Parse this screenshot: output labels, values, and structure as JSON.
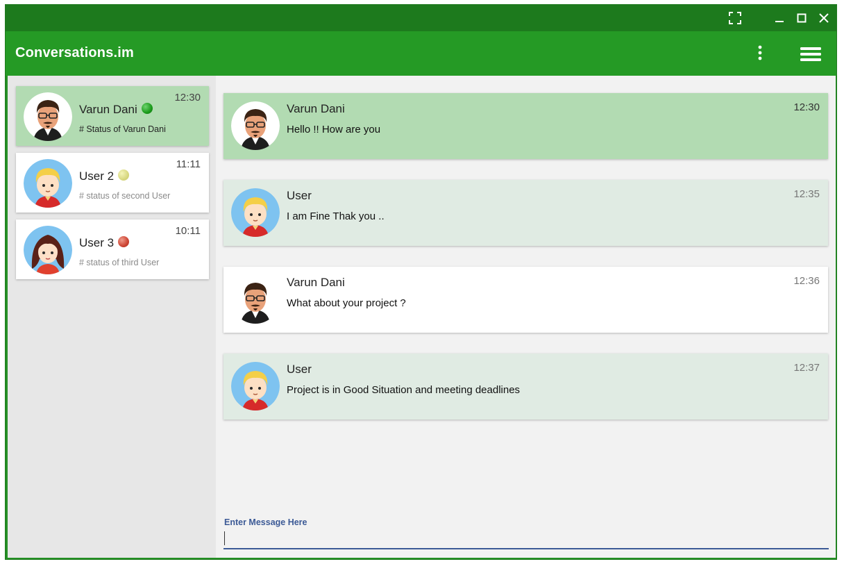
{
  "app": {
    "title": "Conversations.im"
  },
  "window_controls": [
    "fullscreen-icon",
    "minimize-icon",
    "maximize-icon",
    "close-icon"
  ],
  "colors": {
    "titlebar": "#1d7a1d",
    "appbar": "#259a25",
    "active_contact": "#b2dbb2",
    "outgoing_message": "#b2dbb2",
    "incoming_message": "#e0ebe3",
    "plain_message": "#ffffff",
    "input_accent": "#3c5a96"
  },
  "contacts": [
    {
      "name": "Varun Dani",
      "status": "# Status of Varun Dani",
      "time": "12:30",
      "presence_color": "#22a022",
      "active": true,
      "avatar": "man-glasses-avatar"
    },
    {
      "name": "User 2",
      "status": "# status of second User",
      "time": "11:11",
      "presence_color": "#d8d880",
      "active": false,
      "avatar": "boy-avatar"
    },
    {
      "name": "User 3",
      "status": "# status of third User",
      "time": "10:11",
      "presence_color": "#cc4433",
      "active": false,
      "avatar": "girl-avatar"
    }
  ],
  "messages": [
    {
      "sender": "Varun Dani",
      "text": "Hello !! How are you",
      "time": "12:30",
      "style": "outgoing",
      "avatar": "man-glasses-avatar"
    },
    {
      "sender": "User",
      "text": "I am Fine Thak you ..",
      "time": "12:35",
      "style": "incoming",
      "avatar": "boy-avatar"
    },
    {
      "sender": "Varun Dani",
      "text": "What about your project ?",
      "time": "12:36",
      "style": "plain",
      "avatar": "man-glasses-avatar"
    },
    {
      "sender": "User",
      "text": "Project is in Good Situation and meeting deadlines",
      "time": "12:37",
      "style": "incoming",
      "avatar": "boy-avatar"
    }
  ],
  "composer": {
    "label": "Enter Message Here",
    "value": ""
  }
}
